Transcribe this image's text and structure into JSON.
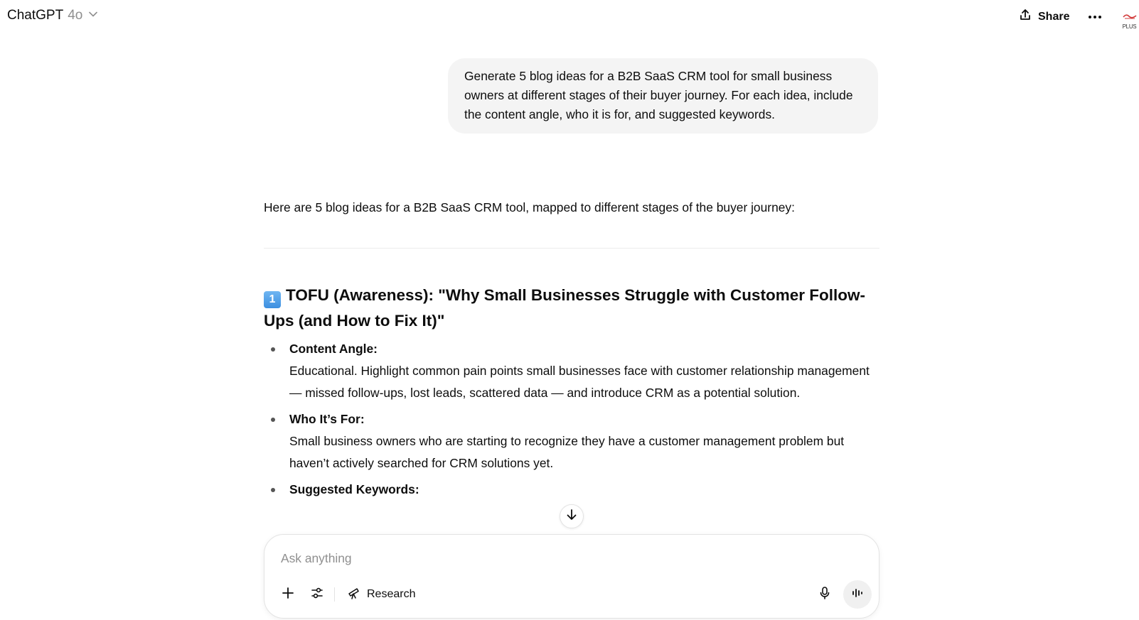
{
  "header": {
    "model_name": "ChatGPT",
    "model_version": "4o",
    "share_label": "Share",
    "avatar_badge": "PLUS"
  },
  "user_message": {
    "text": "Generate 5 blog ideas for a B2B SaaS CRM tool for small business owners at different stages of their buyer journey. For each idea, include the content angle, who it is for, and suggested keywords."
  },
  "assistant": {
    "intro": "Here are 5 blog ideas for a B2B SaaS CRM tool, mapped to different stages of the buyer journey:",
    "sections": [
      {
        "number": "1",
        "heading": "TOFU (Awareness): \"Why Small Businesses Struggle with Customer Follow-Ups (and How to Fix It)\"",
        "bullets": [
          {
            "title": "Content Angle:",
            "text": "Educational. Highlight common pain points small businesses face with customer relationship management — missed follow-ups, lost leads, scattered data — and introduce CRM as a potential solution."
          },
          {
            "title": "Who It’s For:",
            "text": "Small business owners who are starting to recognize they have a customer management problem but haven’t actively searched for CRM solutions yet."
          },
          {
            "title": "Suggested Keywords:",
            "text": ""
          }
        ]
      }
    ]
  },
  "composer": {
    "placeholder": "Ask anything",
    "research_label": "Research"
  },
  "icons": {
    "model_chevron": "chevron-down-icon",
    "share": "share-upload-icon",
    "more": "more-dots-icon",
    "scroll": "arrow-down-icon",
    "plus": "plus-icon",
    "tools": "sliders-icon",
    "research": "telescope-icon",
    "mic": "microphone-icon",
    "voice": "voice-waveform-icon"
  },
  "colors": {
    "accent_keycap": "#3c8fe0",
    "user_bubble_bg": "#f4f4f4",
    "muted_text": "#8f8f8f"
  }
}
